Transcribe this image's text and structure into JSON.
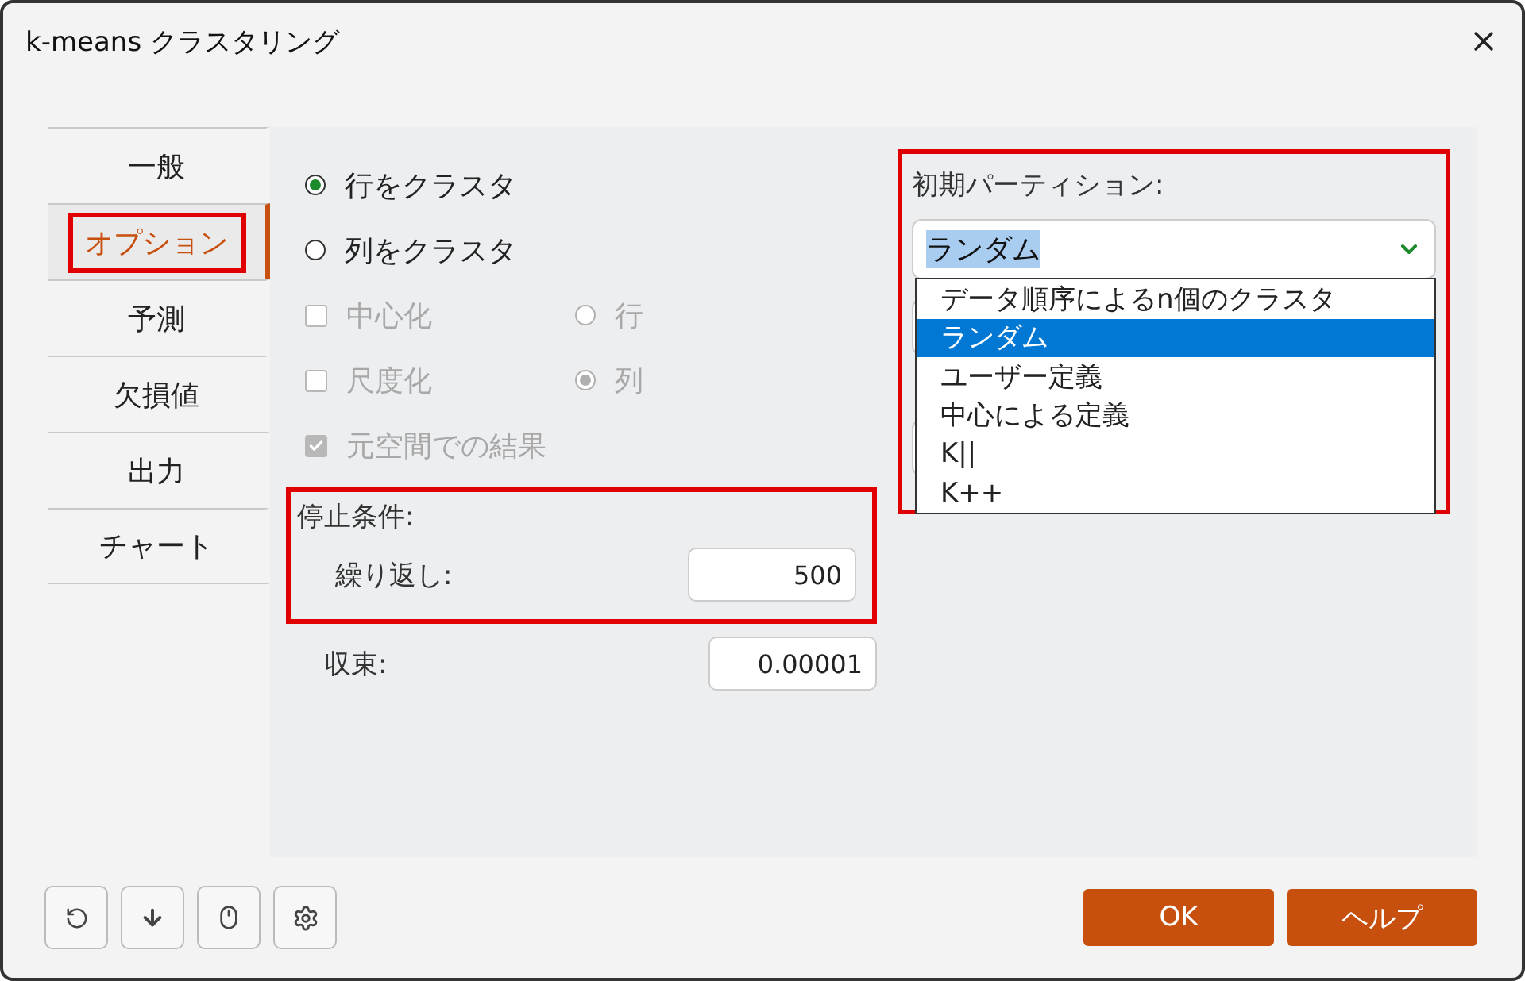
{
  "window": {
    "title": "k-means クラスタリング"
  },
  "tabs": [
    {
      "label": "一般",
      "selected": false,
      "highlighted": false
    },
    {
      "label": "オプション",
      "selected": true,
      "highlighted": true
    },
    {
      "label": "予測",
      "selected": false,
      "highlighted": false
    },
    {
      "label": "欠損値",
      "selected": false,
      "highlighted": false
    },
    {
      "label": "出力",
      "selected": false,
      "highlighted": false
    },
    {
      "label": "チャート",
      "selected": false,
      "highlighted": false
    }
  ],
  "cluster_by": [
    {
      "label": "行をクラスタ",
      "selected": true
    },
    {
      "label": "列をクラスタ",
      "selected": false
    }
  ],
  "standardize": [
    {
      "label": "中心化",
      "checked": false,
      "disabled": true,
      "option": {
        "label": "行",
        "selected": false
      }
    },
    {
      "label": "尺度化",
      "checked": false,
      "disabled": true,
      "option": {
        "label": "列",
        "selected": true
      }
    }
  ],
  "original_space": {
    "label": "元空間での結果",
    "checked": true,
    "disabled": true
  },
  "stop": {
    "title": "停止条件:",
    "highlighted": true,
    "iterations": {
      "label": "繰り返し:",
      "value": "500"
    }
  },
  "convergence": {
    "label": "収束:",
    "value": "0.00001"
  },
  "partition": {
    "label": "初期パーティション:",
    "highlighted": true,
    "value": "ランダム",
    "open": true,
    "options": [
      {
        "label": "データ順序によるn個のクラスタ",
        "selected": false
      },
      {
        "label": "ランダム",
        "selected": true
      },
      {
        "label": "ユーザー定義",
        "selected": false
      },
      {
        "label": "中心による定義",
        "selected": false
      },
      {
        "label": "K||",
        "selected": false
      },
      {
        "label": "K++",
        "selected": false
      }
    ]
  },
  "buttons": [
    {
      "label": "OK"
    },
    {
      "label": "ヘルプ"
    }
  ]
}
